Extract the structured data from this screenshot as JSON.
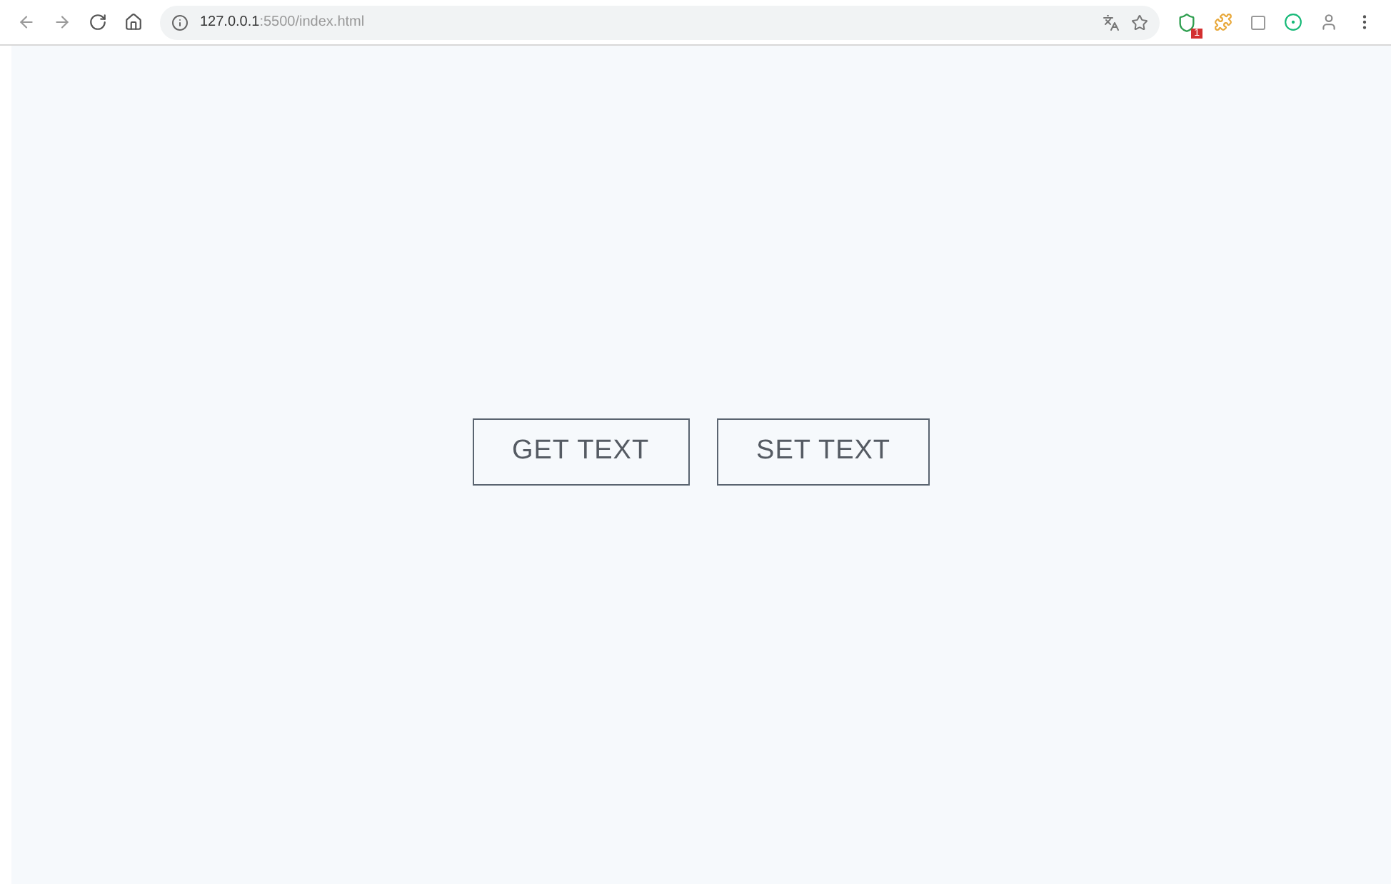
{
  "browser": {
    "url_host": "127.0.0.1",
    "url_rest": ":5500/index.html",
    "extension_badge": "1"
  },
  "buttons": [
    {
      "label": "GET TEXT"
    },
    {
      "label": "SET TEXT"
    }
  ]
}
